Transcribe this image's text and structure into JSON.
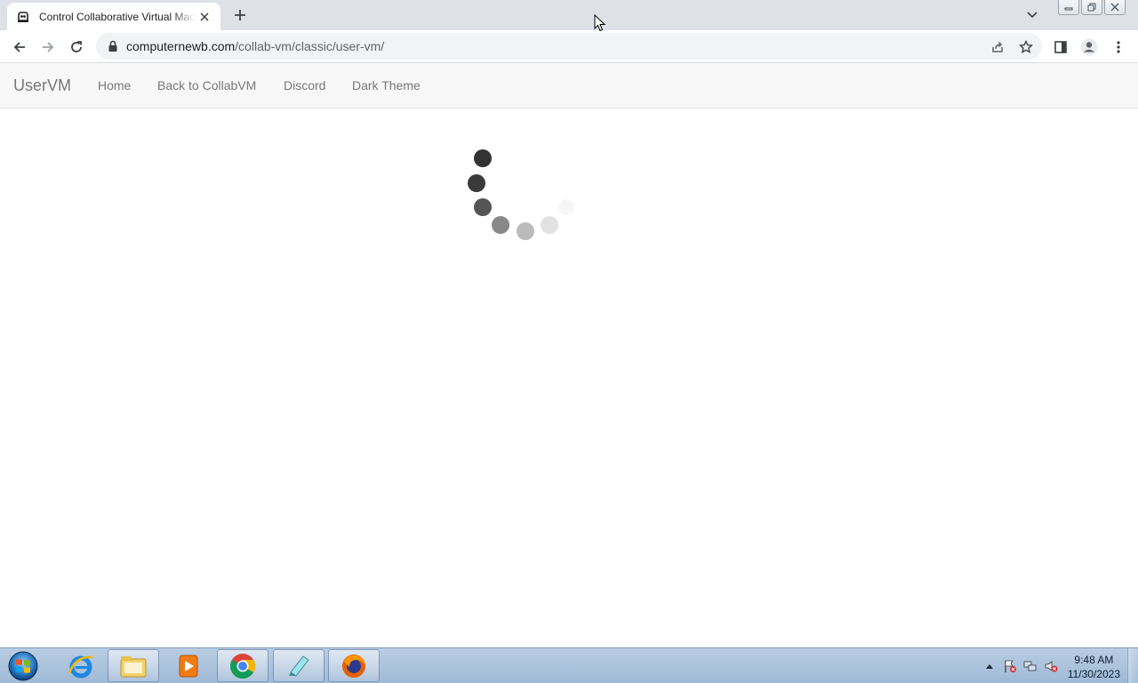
{
  "browser": {
    "tab_title": "Control Collaborative Virtual Machines",
    "url_host": "computernewb.com",
    "url_path": "/collab-vm/classic/user-vm/"
  },
  "navbar": {
    "brand": "UserVM",
    "links": [
      "Home",
      "Back to CollabVM",
      "Discord",
      "Dark Theme"
    ]
  },
  "page": {
    "state": "loading",
    "spinner_dot_colors": [
      "#333333",
      "#3a3a3a",
      "#555555",
      "#888888",
      "#bbbbbb",
      "#e2e2e2",
      "#f6f6f6"
    ]
  },
  "taskbar": {
    "apps": [
      "internet-explorer-icon",
      "file-explorer-icon",
      "media-player-icon",
      "chrome-icon",
      "notepad-icon",
      "firefox-icon"
    ],
    "clock_time": "9:48 AM",
    "clock_date": "11/30/2023"
  },
  "colors": {
    "tab_strip": "#dee1e6",
    "navbar_bg": "#f8f8f8",
    "navbar_text": "#777777",
    "taskbar": "#a9c2dc"
  }
}
